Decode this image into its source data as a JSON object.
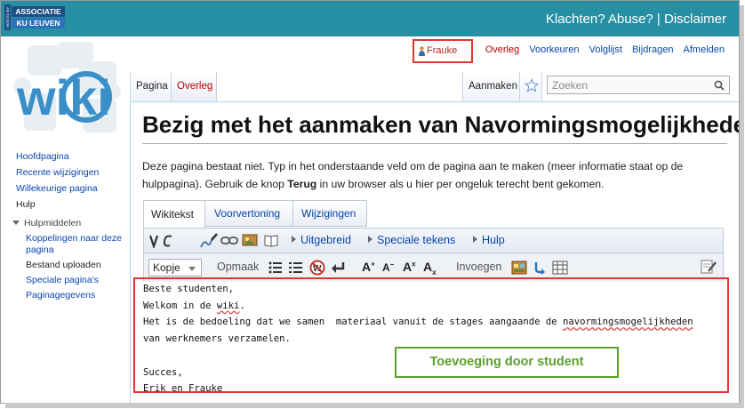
{
  "banner": {
    "assoc_vertical": "HOSTED BY",
    "assoc_line1": "ASSOCIATIE",
    "assoc_line2": "KU LEUVEN",
    "links": "Klachten? Abuse? | Disclaimer"
  },
  "personal": {
    "user": "Frauke",
    "items": [
      "Overleg",
      "Voorkeuren",
      "Volglijst",
      "Bijdragen",
      "Afmelden"
    ]
  },
  "logo": {
    "text": "wiki"
  },
  "navigation": {
    "items": [
      "Hoofdpagina",
      "Recente wijzigingen",
      "Willekeurige pagina",
      "Hulp"
    ]
  },
  "tools": {
    "heading": "Hulpmiddelen",
    "items": [
      "Koppelingen naar deze pagina",
      "Bestand uploaden",
      "Speciale pagina's",
      "Paginagegevens"
    ]
  },
  "tabs": {
    "page": "Pagina",
    "talk": "Overleg",
    "create": "Aanmaken"
  },
  "search": {
    "placeholder": "Zoeken"
  },
  "page": {
    "title": "Bezig met het aanmaken van Navormingsmogelijkheden",
    "intro_1": "Deze pagina bestaat niet. Typ in het onderstaande veld om de pagina aan te maken (meer informatie staat op de hulppagina). Gebruik de knop ",
    "intro_bold": "Terug",
    "intro_2": " in uw browser als u hier per ongeluk terecht bent gekomen."
  },
  "editor_tabs": [
    "Wikitekst",
    "Voorvertoning",
    "Wijzigingen"
  ],
  "toolbar": {
    "advanced": "Uitgebreid",
    "special_chars": "Speciale tekens",
    "help": "Hulp",
    "heading_select": "Kopje",
    "format": "Opmaak",
    "insert": "Invoegen"
  },
  "editor": {
    "line1": "Beste studenten,",
    "line2_pre": "Welkom in de ",
    "line2_link": "wiki",
    "line2_post": ".",
    "line3_pre": "Het is de bedoeling dat we samen  materiaal vanuit de stages aangaande de ",
    "line3_word": "navormingsmogelijkheden",
    "line4": "van werknemers verzamelen.",
    "line5": "",
    "line6": "Succes,",
    "line7": "Erik en Frauke"
  },
  "callout": "Toevoeging door student",
  "colors": {
    "banner": "#268fa3",
    "highlight_red": "#d9382f",
    "callout_green": "#5aa12b",
    "link_blue": "#0645ad",
    "redlink": "#ba0000"
  }
}
